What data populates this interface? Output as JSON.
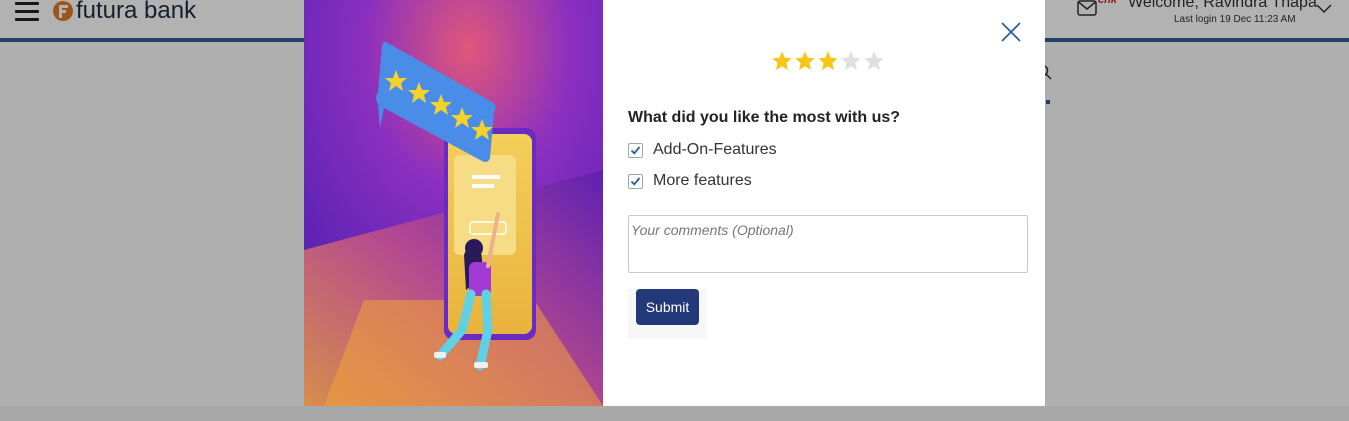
{
  "app": {
    "brand": "futura bank",
    "welcome": "Welcome, Ravindra Thapa",
    "last_login": "Last login 19 Dec 11:23 AM",
    "mail_badge": "chk",
    "icons": [
      "menu-icon",
      "bank-logo-icon",
      "mail-icon",
      "chevron-down-icon",
      "search-icon"
    ]
  },
  "modal": {
    "rating": {
      "value": 3,
      "max": 5,
      "filled_color": "#f5c518",
      "empty_color": "#e0e0e0"
    },
    "question": "What did you like the most with us?",
    "options": [
      {
        "label": "Add-On-Features",
        "checked": true
      },
      {
        "label": "More features",
        "checked": true
      }
    ],
    "comment": {
      "value": "",
      "placeholder": "Your comments (Optional)"
    },
    "submit_label": "Submit",
    "close_icon": "close-icon"
  },
  "colors": {
    "accent": "#2e5c99",
    "button": "#23397a",
    "illustration_purple": "#5a1fb0",
    "illustration_yellow": "#f1c84b"
  }
}
